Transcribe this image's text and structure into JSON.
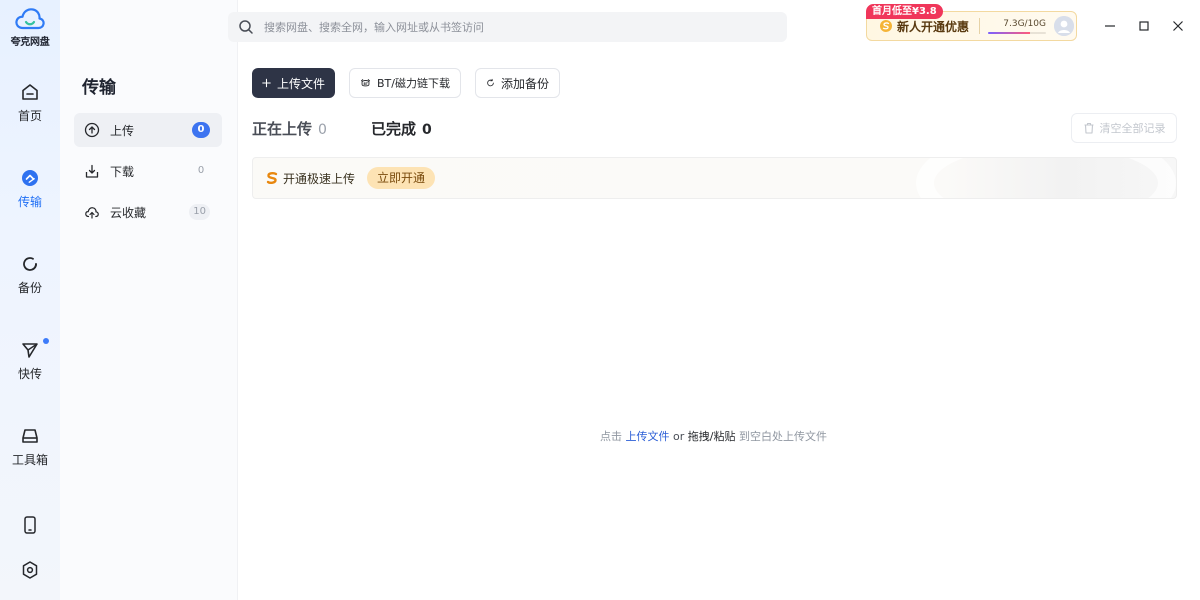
{
  "app": {
    "logo_text": "夸克网盘"
  },
  "rail": {
    "items": [
      {
        "label": "首页"
      },
      {
        "label": "传输"
      },
      {
        "label": "备份"
      },
      {
        "label": "快传"
      },
      {
        "label": "工具箱"
      }
    ]
  },
  "search": {
    "placeholder": "搜索网盘、搜索全网，输入网址或从书签访问"
  },
  "promo": {
    "tag": "首月低至¥3.8",
    "text": "新人开通优惠",
    "storage": "7.3G/10G",
    "storage_used_fraction": 0.73
  },
  "subnav": {
    "title": "传输",
    "items": [
      {
        "label": "上传",
        "count": "0"
      },
      {
        "label": "下载",
        "count": "0"
      },
      {
        "label": "云收藏",
        "count": "10"
      }
    ]
  },
  "toolbar": {
    "upload_label": "上传文件",
    "bt_label": "BT/磁力链下载",
    "backup_label": "添加备份",
    "clear_label": "清空全部记录"
  },
  "tabs": {
    "uploading_label": "正在上传",
    "uploading_count": "0",
    "done_label": "已完成",
    "done_count": "0"
  },
  "banner": {
    "text": "开通极速上传",
    "button": "立即开通"
  },
  "empty": {
    "prefix": "点击",
    "link": "上传文件",
    "or": "or",
    "drag": "拖拽/粘贴",
    "suffix": "到空白处上传文件"
  }
}
